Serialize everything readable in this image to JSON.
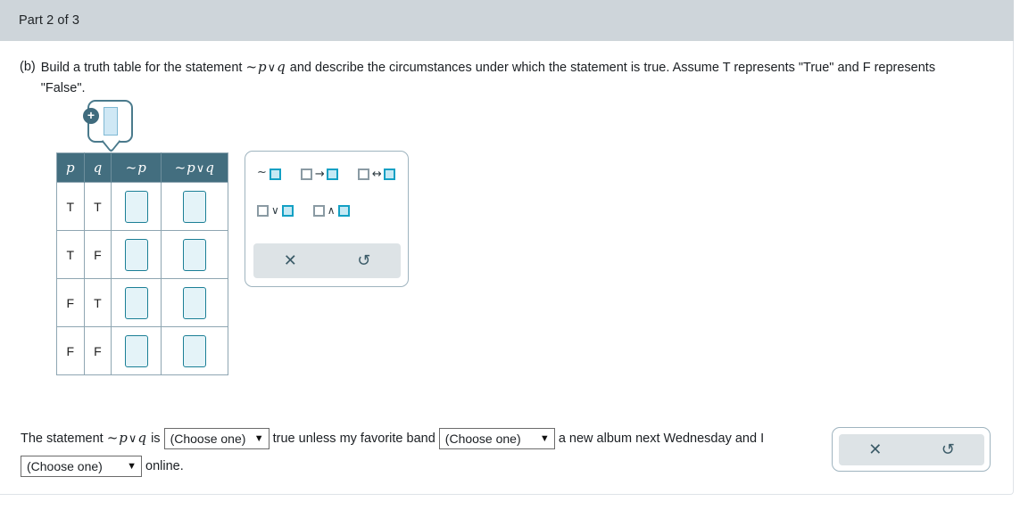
{
  "header": {
    "part_label": "Part 2 of 3",
    "bg_color": "#ced5da"
  },
  "question": {
    "label": "(b)",
    "text_before": "Build a truth table for the statement",
    "statement_neg": "~",
    "statement_p": "p",
    "statement_op": "∨",
    "statement_q": "q",
    "text_after": "and describe the circumstances under which the statement is true. Assume T represents \"True\" and F represents \"False\"."
  },
  "add_column_tooltip": {
    "name": "add-column",
    "plus_glyph": "+"
  },
  "truth_table": {
    "headers": [
      "p",
      "q",
      "~ p",
      "~ p∨q"
    ],
    "header_parts": [
      {
        "tilde": "",
        "var": "p",
        "op": "",
        "var2": ""
      },
      {
        "tilde": "",
        "var": "q",
        "op": "",
        "var2": ""
      },
      {
        "tilde": "~",
        "var": "p",
        "op": "",
        "var2": ""
      },
      {
        "tilde": "~",
        "var": "p",
        "op": "∨",
        "var2": "q"
      }
    ],
    "rows": [
      {
        "p": "T",
        "q": "T",
        "np": "",
        "npq": ""
      },
      {
        "p": "T",
        "q": "F",
        "np": "",
        "npq": ""
      },
      {
        "p": "F",
        "q": "T",
        "np": "",
        "npq": ""
      },
      {
        "p": "F",
        "q": "F",
        "np": "",
        "npq": ""
      }
    ],
    "header_bg": "#436e7f",
    "answer_box_bg": "#e4f3f8",
    "answer_box_border": "#1b7f96"
  },
  "palette": {
    "symbols": [
      {
        "name": "not-operator",
        "prefix": "~",
        "op": "",
        "left_box": false,
        "right_box": true
      },
      {
        "name": "implies-operator",
        "prefix": "",
        "op": "→",
        "left_box": true,
        "right_box": true
      },
      {
        "name": "iff-operator",
        "prefix": "",
        "op": "↔",
        "left_box": true,
        "right_box": true
      },
      {
        "name": "or-operator",
        "prefix": "",
        "op": "∨",
        "left_box": true,
        "right_box": true
      },
      {
        "name": "and-operator",
        "prefix": "",
        "op": "∧",
        "left_box": true,
        "right_box": true
      }
    ],
    "clear_glyph": "✕",
    "undo_glyph": "↺",
    "actions_bg": "#dde3e6"
  },
  "statement": {
    "prefix": "The statement",
    "neg": "~",
    "var_p": "p",
    "op": "∨",
    "var_q": "q",
    "after_expr": "is",
    "dropdown1": "(Choose one)",
    "mid1": "true unless my favorite band",
    "dropdown2": "(Choose one)",
    "mid2": "a new album next Wednesday",
    "mid3": "and I",
    "dropdown3": "(Choose one)",
    "suffix": "online.",
    "caret_glyph": "▼"
  },
  "action_panel": {
    "clear_glyph": "✕",
    "undo_glyph": "↺"
  }
}
